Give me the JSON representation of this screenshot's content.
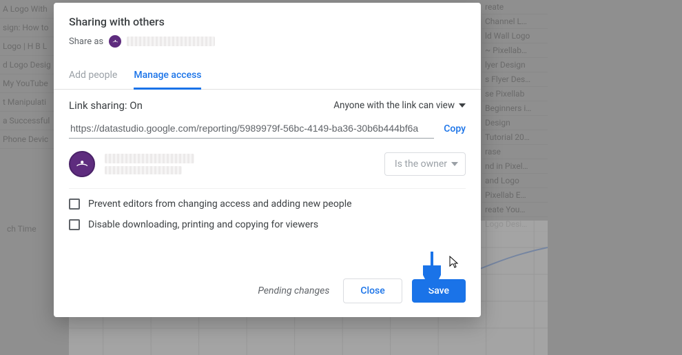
{
  "dialog": {
    "title": "Sharing with others",
    "share_as_label": "Share as",
    "tabs": {
      "add_people": "Add people",
      "manage_access": "Manage access"
    },
    "link_sharing_label": "Link sharing: On",
    "permission": "Anyone with the link can view",
    "url": "https://datastudio.google.com/reporting/5989979f-56bc-4149-ba36-30b6b444bf6a",
    "copy_label": "Copy",
    "owner_chip": "Is the owner",
    "check_prevent": "Prevent editors from changing access and adding new people",
    "check_disable": "Disable downloading, printing and copying for viewers",
    "pending": "Pending changes",
    "close": "Close",
    "save": "Save"
  },
  "bg": {
    "watch_time": "ch Time",
    "left_rows": [
      "A Logo With",
      "sign: How to",
      "Logo | H B L",
      "d Logo Desig",
      "My YouTube",
      "t Manipulati",
      "a Successful",
      "Phone Devic"
    ],
    "right_rows": [
      "reate",
      "Channel L…",
      "ld Wall Logo",
      "~ Pixellab…",
      "lyer Design",
      "s Flyer Des…",
      "se Pixellab",
      "Beginners i…",
      "Design",
      "Tutorial 20…",
      "rase",
      "nd in Pixel…",
      "and Logo",
      "Pixellab E…",
      "reate You…",
      "Logo Desi…"
    ]
  },
  "colors": {
    "accent": "#1a73e8",
    "avatar": "#5e2c7e"
  }
}
